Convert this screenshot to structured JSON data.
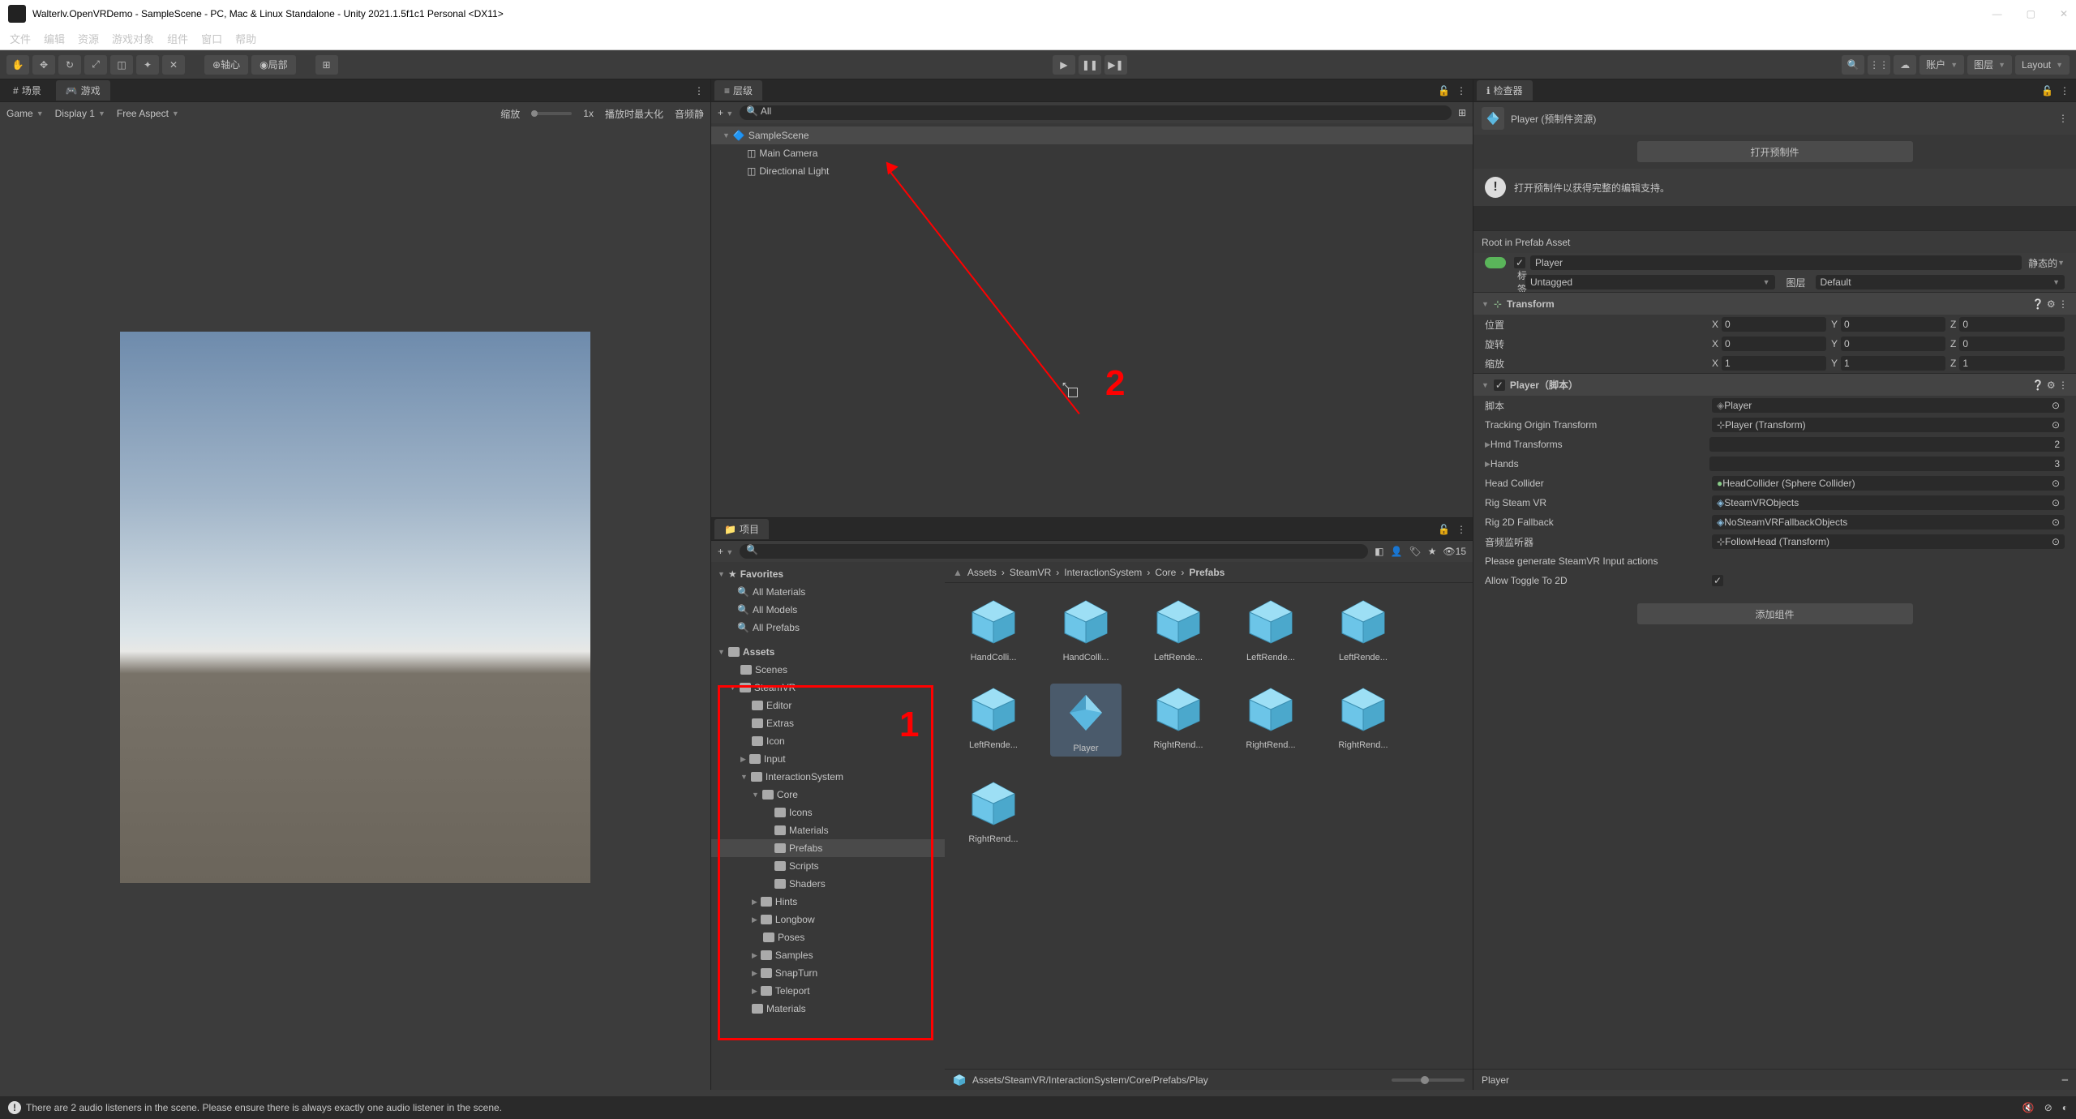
{
  "titlebar": {
    "title": "Walterlv.OpenVRDemo - SampleScene - PC, Mac & Linux Standalone - Unity 2021.1.5f1c1 Personal <DX11>"
  },
  "menubar": {
    "file": "文件",
    "edit": "编辑",
    "assets": "资源",
    "gameobject": "游戏对象",
    "component": "组件",
    "window": "窗口",
    "help": "帮助"
  },
  "toolbar": {
    "pivot": "轴心",
    "local": "局部",
    "account": "账户",
    "layers": "图层",
    "layout": "Layout"
  },
  "scene_tab": "场景",
  "game_tab": "游戏",
  "game_toolbar": {
    "game": "Game",
    "display": "Display 1",
    "aspect": "Free Aspect",
    "scale_label": "缩放",
    "scale_value": "1x",
    "maximize": "播放时最大化",
    "audio": "音频静"
  },
  "hierarchy": {
    "tab": "层级",
    "search_ph": "All",
    "scene": "SampleScene",
    "main_camera": "Main Camera",
    "directional_light": "Directional Light"
  },
  "project": {
    "tab": "项目",
    "favorites": "Favorites",
    "all_materials": "All Materials",
    "all_models": "All Models",
    "all_prefabs": "All Prefabs",
    "assets": "Assets",
    "scenes": "Scenes",
    "steamvr": "SteamVR",
    "editor": "Editor",
    "extras": "Extras",
    "icon": "Icon",
    "input": "Input",
    "interaction_system": "InteractionSystem",
    "core": "Core",
    "icons": "Icons",
    "materials": "Materials",
    "prefabs": "Prefabs",
    "scripts": "Scripts",
    "shaders": "Shaders",
    "hints": "Hints",
    "longbow": "Longbow",
    "poses": "Poses",
    "samples": "Samples",
    "snapturn": "SnapTurn",
    "teleport": "Teleport",
    "materials2": "Materials",
    "breadcrumb": {
      "assets": "Assets",
      "steamvr": "SteamVR",
      "is": "InteractionSystem",
      "core": "Core",
      "prefabs": "Prefabs"
    },
    "count": "15",
    "items": [
      "HandColli...",
      "HandColli...",
      "LeftRende...",
      "LeftRende...",
      "LeftRende...",
      "LeftRende...",
      "Player",
      "RightRend...",
      "RightRend...",
      "RightRend...",
      "RightRend..."
    ],
    "bottom_path": "Assets/SteamVR/InteractionSystem/Core/Prefabs/Play"
  },
  "inspector": {
    "tab": "检查器",
    "asset_type": "Player (预制件资源)",
    "open_prefab": "打开预制件",
    "info": "打开预制件以获得完整的编辑支持。",
    "root_section": "Root in Prefab Asset",
    "name": "Player",
    "static": "静态的",
    "tag_label": "标签",
    "tag_value": "Untagged",
    "layer_label": "图层",
    "layer_value": "Default",
    "transform_label": "Transform",
    "position": "位置",
    "rotation": "旋转",
    "scale": "缩放",
    "pos_x": "0",
    "pos_y": "0",
    "pos_z": "0",
    "rot_x": "0",
    "rot_y": "0",
    "rot_z": "0",
    "scl_x": "1",
    "scl_y": "1",
    "scl_z": "1",
    "player_script": "Player（脚本）",
    "script_label": "脚本",
    "script_value": "Player",
    "tracking_label": "Tracking Origin Transform",
    "tracking_value": "Player (Transform)",
    "hmd_label": "Hmd Transforms",
    "hmd_value": "2",
    "hands_label": "Hands",
    "hands_value": "3",
    "head_collider_label": "Head Collider",
    "head_collider_value": "HeadCollider (Sphere Collider)",
    "rig_steam_label": "Rig Steam VR",
    "rig_steam_value": "SteamVRObjects",
    "rig_2d_label": "Rig 2D Fallback",
    "rig_2d_value": "NoSteamVRFallbackObjects",
    "audio_listener_label": "音频监听器",
    "audio_listener_value": "FollowHead (Transform)",
    "generate_label": "Please generate SteamVR Input actions",
    "toggle_label": "Allow Toggle To 2D",
    "add_component": "添加组件",
    "bottom_name": "Player"
  },
  "footer": {
    "message": "There are 2 audio listeners in the scene. Please ensure there is always exactly one audio listener in the scene."
  },
  "annotations": {
    "one": "1",
    "two": "2"
  }
}
